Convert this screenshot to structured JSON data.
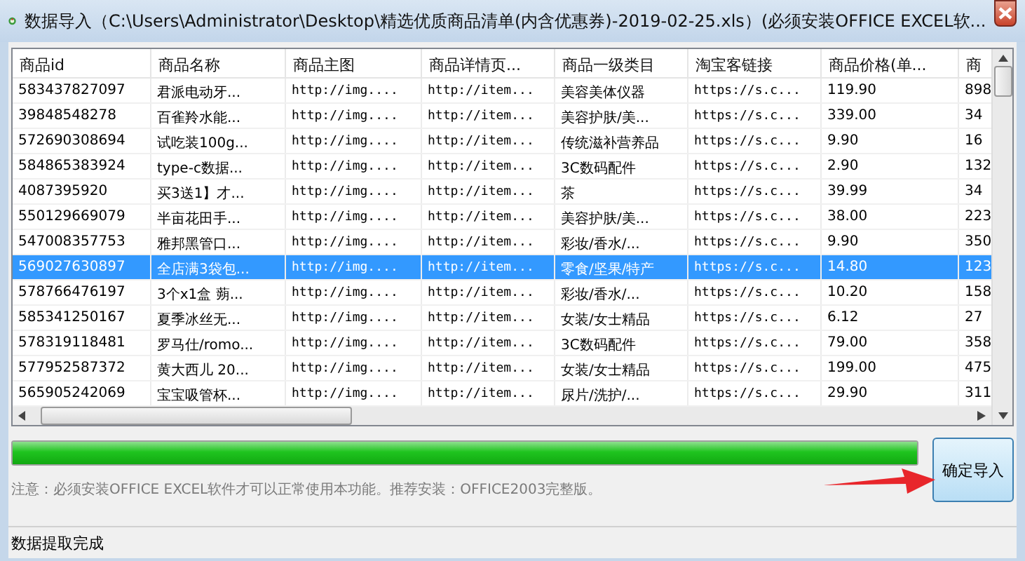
{
  "window": {
    "title": "数据导入（C:\\Users\\Administrator\\Desktop\\精选优质商品清单(内含优惠券)-2019-02-25.xls）(必须安装OFFICE EXCEL软..."
  },
  "table": {
    "columns": [
      "商品id",
      "商品名称",
      "商品主图",
      "商品详情页...",
      "商品一级类目",
      "淘宝客链接",
      "商品价格(单...",
      "商"
    ],
    "rows": [
      {
        "selected": false,
        "cells": [
          "583437827097",
          "君派电动牙...",
          "http://img....",
          "http://item...",
          "美容美体仪器",
          "https://s.c...",
          "119.90",
          "898"
        ]
      },
      {
        "selected": false,
        "cells": [
          "39848548278",
          "百雀羚水能...",
          "http://img....",
          "http://item...",
          "美容护肤/美...",
          "https://s.c...",
          "339.00",
          "34"
        ]
      },
      {
        "selected": false,
        "cells": [
          "572690308694",
          "试吃装100g...",
          "http://img....",
          "http://item...",
          "传统滋补营养品",
          "https://s.c...",
          "9.90",
          "16"
        ]
      },
      {
        "selected": false,
        "cells": [
          "584865383924",
          "type-c数据...",
          "http://img....",
          "http://item...",
          "3C数码配件",
          "https://s.c...",
          "2.90",
          "132"
        ]
      },
      {
        "selected": false,
        "cells": [
          "4087395920",
          "买3送1】才...",
          "http://img....",
          "http://item...",
          "茶",
          "https://s.c...",
          "39.99",
          "34"
        ]
      },
      {
        "selected": false,
        "cells": [
          "550129669079",
          "半亩花田手...",
          "http://img....",
          "http://item...",
          "美容护肤/美...",
          "https://s.c...",
          "38.00",
          "223"
        ]
      },
      {
        "selected": false,
        "cells": [
          "547008357753",
          "雅邦黑管口...",
          "http://img....",
          "http://item...",
          "彩妆/香水/...",
          "https://s.c...",
          "9.90",
          "350"
        ]
      },
      {
        "selected": true,
        "cells": [
          "569027630897",
          "全店满3袋包...",
          "http://img....",
          "http://item...",
          "零食/坚果/特产",
          "https://s.c...",
          "14.80",
          "123"
        ]
      },
      {
        "selected": false,
        "cells": [
          "578766476197",
          "3个x1盒 蒴...",
          "http://img....",
          "http://item...",
          "彩妆/香水/...",
          "https://s.c...",
          "10.20",
          "158"
        ]
      },
      {
        "selected": false,
        "cells": [
          "585341250167",
          "夏季冰丝无...",
          "http://img....",
          "http://item...",
          "女装/女士精品",
          "https://s.c...",
          "6.12",
          "27"
        ]
      },
      {
        "selected": false,
        "cells": [
          "578319118481",
          "罗马仕/romo...",
          "http://img....",
          "http://item...",
          "3C数码配件",
          "https://s.c...",
          "79.00",
          "358"
        ]
      },
      {
        "selected": false,
        "cells": [
          "577952587372",
          "黄大西儿 20...",
          "http://img....",
          "http://item...",
          "女装/女士精品",
          "https://s.c...",
          "199.00",
          "475"
        ]
      },
      {
        "selected": false,
        "cells": [
          "565905242069",
          "宝宝吸管杯...",
          "http://img....",
          "http://item...",
          "尿片/洗护/...",
          "https://s.c...",
          "29.90",
          "311"
        ]
      }
    ]
  },
  "progress": {
    "level": 1.0
  },
  "note": "注意：必须安装OFFICE EXCEL软件才可以正常使用本功能。推荐安装：OFFICE2003完整版。",
  "confirm_button": "确定导入",
  "status_bar": "数据提取完成"
}
